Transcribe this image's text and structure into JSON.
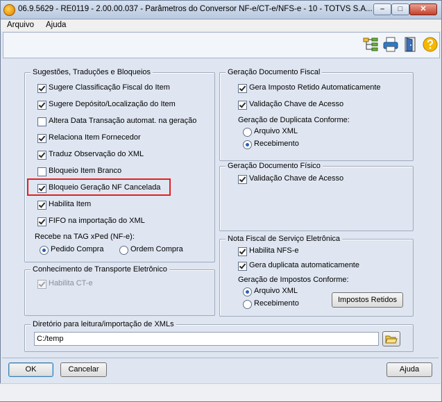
{
  "window": {
    "title": "06.9.5629 - RE0119 - 2.00.00.037 - Parâmetros do Conversor NF-e/CT-e/NFS-e - 10 - TOTVS S.A...",
    "minimize": "–",
    "maximize": "□",
    "close": "✕"
  },
  "menu": [
    "Arquivo",
    "Ajuda"
  ],
  "sugestoes": {
    "legend": "Sugestões, Traduções e Bloqueios",
    "items": [
      {
        "label": "Sugere Classificação Fiscal do Item",
        "checked": true
      },
      {
        "label": "Sugere Depósito/Localização do Item",
        "checked": true
      },
      {
        "label": "Altera Data Transação automat. na geração",
        "checked": false
      },
      {
        "label": "Relaciona Item Fornecedor",
        "checked": true
      },
      {
        "label": "Traduz Observação do XML",
        "checked": true
      },
      {
        "label": "Bloqueio Item Branco",
        "checked": false
      },
      {
        "label": "Bloqueio Geração NF Cancelada",
        "checked": true
      },
      {
        "label": "Habilita Item",
        "checked": true
      },
      {
        "label": "FIFO na importação do XML",
        "checked": true
      }
    ],
    "xped_label": "Recebe na TAG xPed (NF-e):",
    "xped_options": [
      {
        "label": "Pedido Compra",
        "checked": true
      },
      {
        "label": "Ordem Compra",
        "checked": false
      }
    ]
  },
  "cte": {
    "legend": "Conhecimento de Transporte Eletrônico",
    "habilita": {
      "label": "Habilita CT-e",
      "checked": true
    }
  },
  "doc_fiscal": {
    "legend": "Geração Documento Fiscal",
    "items": [
      {
        "label": "Gera Imposto Retido Automaticamente",
        "checked": true
      },
      {
        "label": "Validação Chave de Acesso",
        "checked": true
      }
    ],
    "dup_label": "Geração de Duplicata Conforme:",
    "dup_options": [
      {
        "label": "Arquivo XML",
        "checked": false
      },
      {
        "label": "Recebimento",
        "checked": true
      }
    ]
  },
  "doc_fisico": {
    "legend": "Geração Documento Físico",
    "validacao": {
      "label": "Validação Chave de Acesso",
      "checked": true
    }
  },
  "nfse": {
    "legend": "Nota Fiscal de Serviço Eletrônica",
    "items": [
      {
        "label": "Habilita NFS-e",
        "checked": true
      },
      {
        "label": "Gera duplicata automaticamente",
        "checked": true
      }
    ],
    "imp_label": "Geração de Impostos Conforme:",
    "imp_options": [
      {
        "label": "Arquivo XML",
        "checked": true
      },
      {
        "label": "Recebimento",
        "checked": false
      }
    ],
    "impostos_button": "Impostos Retidos"
  },
  "diretorio": {
    "legend": "Diretório para leitura/importação de XMLs",
    "value": "C:/temp"
  },
  "buttons": {
    "ok": "OK",
    "cancel": "Cancelar",
    "help": "Ajuda"
  },
  "colors": {
    "highlight_box": "#e02020",
    "accent": "#2a5fb0"
  }
}
